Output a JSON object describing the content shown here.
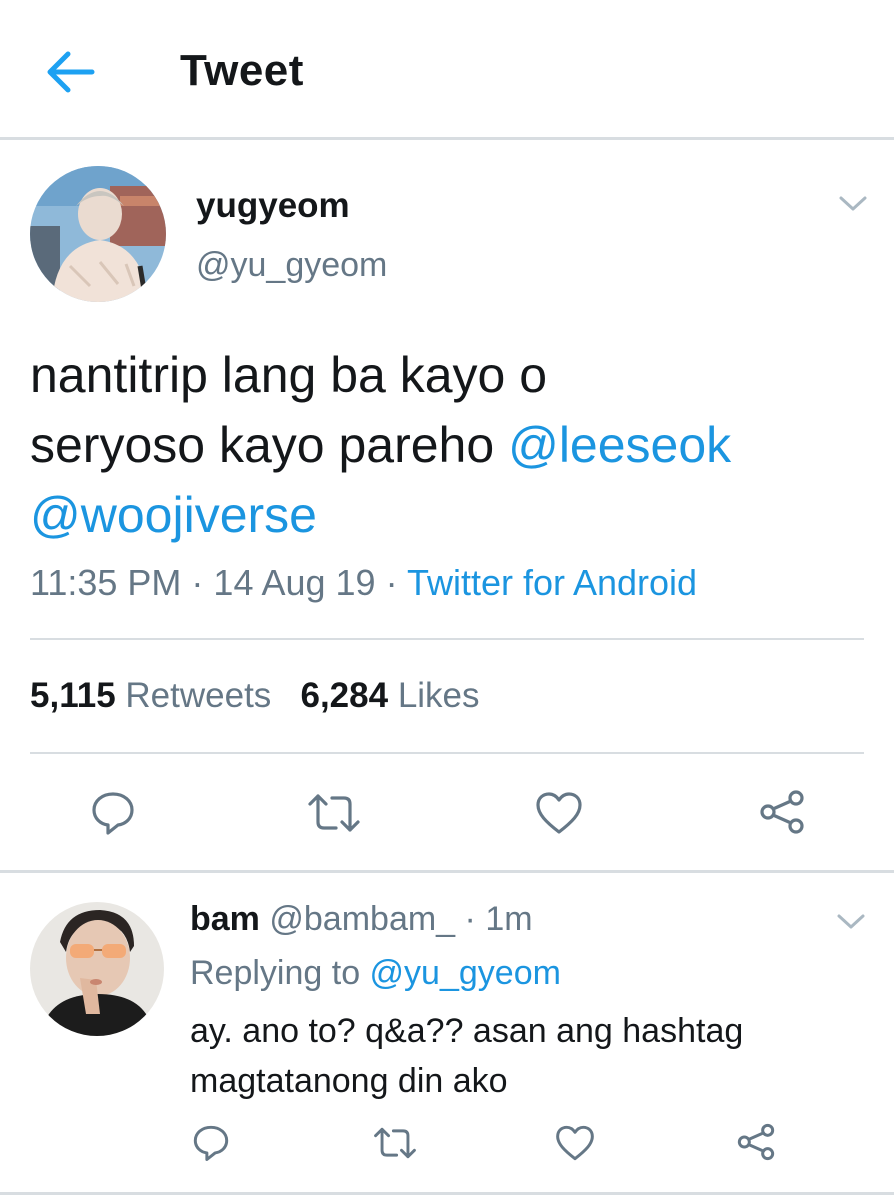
{
  "header": {
    "title": "Tweet",
    "back_icon": "arrow-left-icon",
    "accent": "#1da1f2"
  },
  "tweet": {
    "author_name": "yugyeom",
    "author_handle": "@yu_gyeom",
    "text_line1": "nantitrip lang ba kayo o",
    "text_line2": "seryoso kayo pareho ",
    "mention1": "@leeseok",
    "mention2": "@woojiverse",
    "time": "11:35 PM",
    "sep": " · ",
    "date": "14 Aug 19",
    "source": "Twitter for Android",
    "retweets_count": "5,115",
    "retweets_label": "Retweets",
    "likes_count": "6,284",
    "likes_label": "Likes",
    "actions": [
      "reply-icon",
      "retweet-icon",
      "like-icon",
      "share-icon"
    ]
  },
  "reply": {
    "author_name": "bam",
    "author_handle": "@bambam_",
    "time_sep": " · ",
    "time": "1m",
    "replying_prefix": "Replying to ",
    "replying_handle": "@yu_gyeom",
    "text_line1": "ay. ano to? q&a?? asan ang hashtag",
    "text_line2": "magtatanong din ako"
  },
  "colors": {
    "link": "#1b95e0",
    "secondary": "#657786",
    "divider": "#d8dde1"
  }
}
